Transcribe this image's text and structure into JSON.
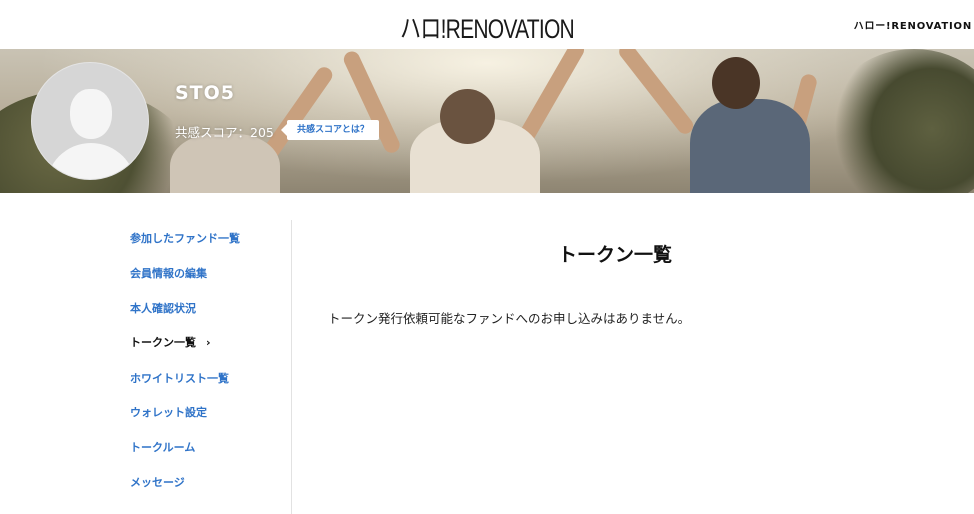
{
  "header": {
    "logo": "ハロ!RENOVATION",
    "brand_link": "ハロー!RENOVATION"
  },
  "profile": {
    "username": "STO5",
    "score_text": "共感スコア：205",
    "score_help": "共感スコアとは？"
  },
  "sidebar": {
    "items": [
      {
        "label": "参加したファンド一覧"
      },
      {
        "label": "会員情報の編集"
      },
      {
        "label": "本人確認状況"
      },
      {
        "label": "トークン一覧",
        "chevron": "›"
      },
      {
        "label": "ホワイトリスト一覧"
      },
      {
        "label": "ウォレット設定"
      },
      {
        "label": "トークルーム"
      },
      {
        "label": "メッセージ"
      }
    ],
    "active_index": 3
  },
  "main": {
    "title": "トークン一覧",
    "empty_message": "トークン発行依頼可能なファンドへのお申し込みはありません。"
  },
  "colors": {
    "link": "#2f73c8",
    "text": "#111111",
    "divider": "#e2e2e2"
  }
}
